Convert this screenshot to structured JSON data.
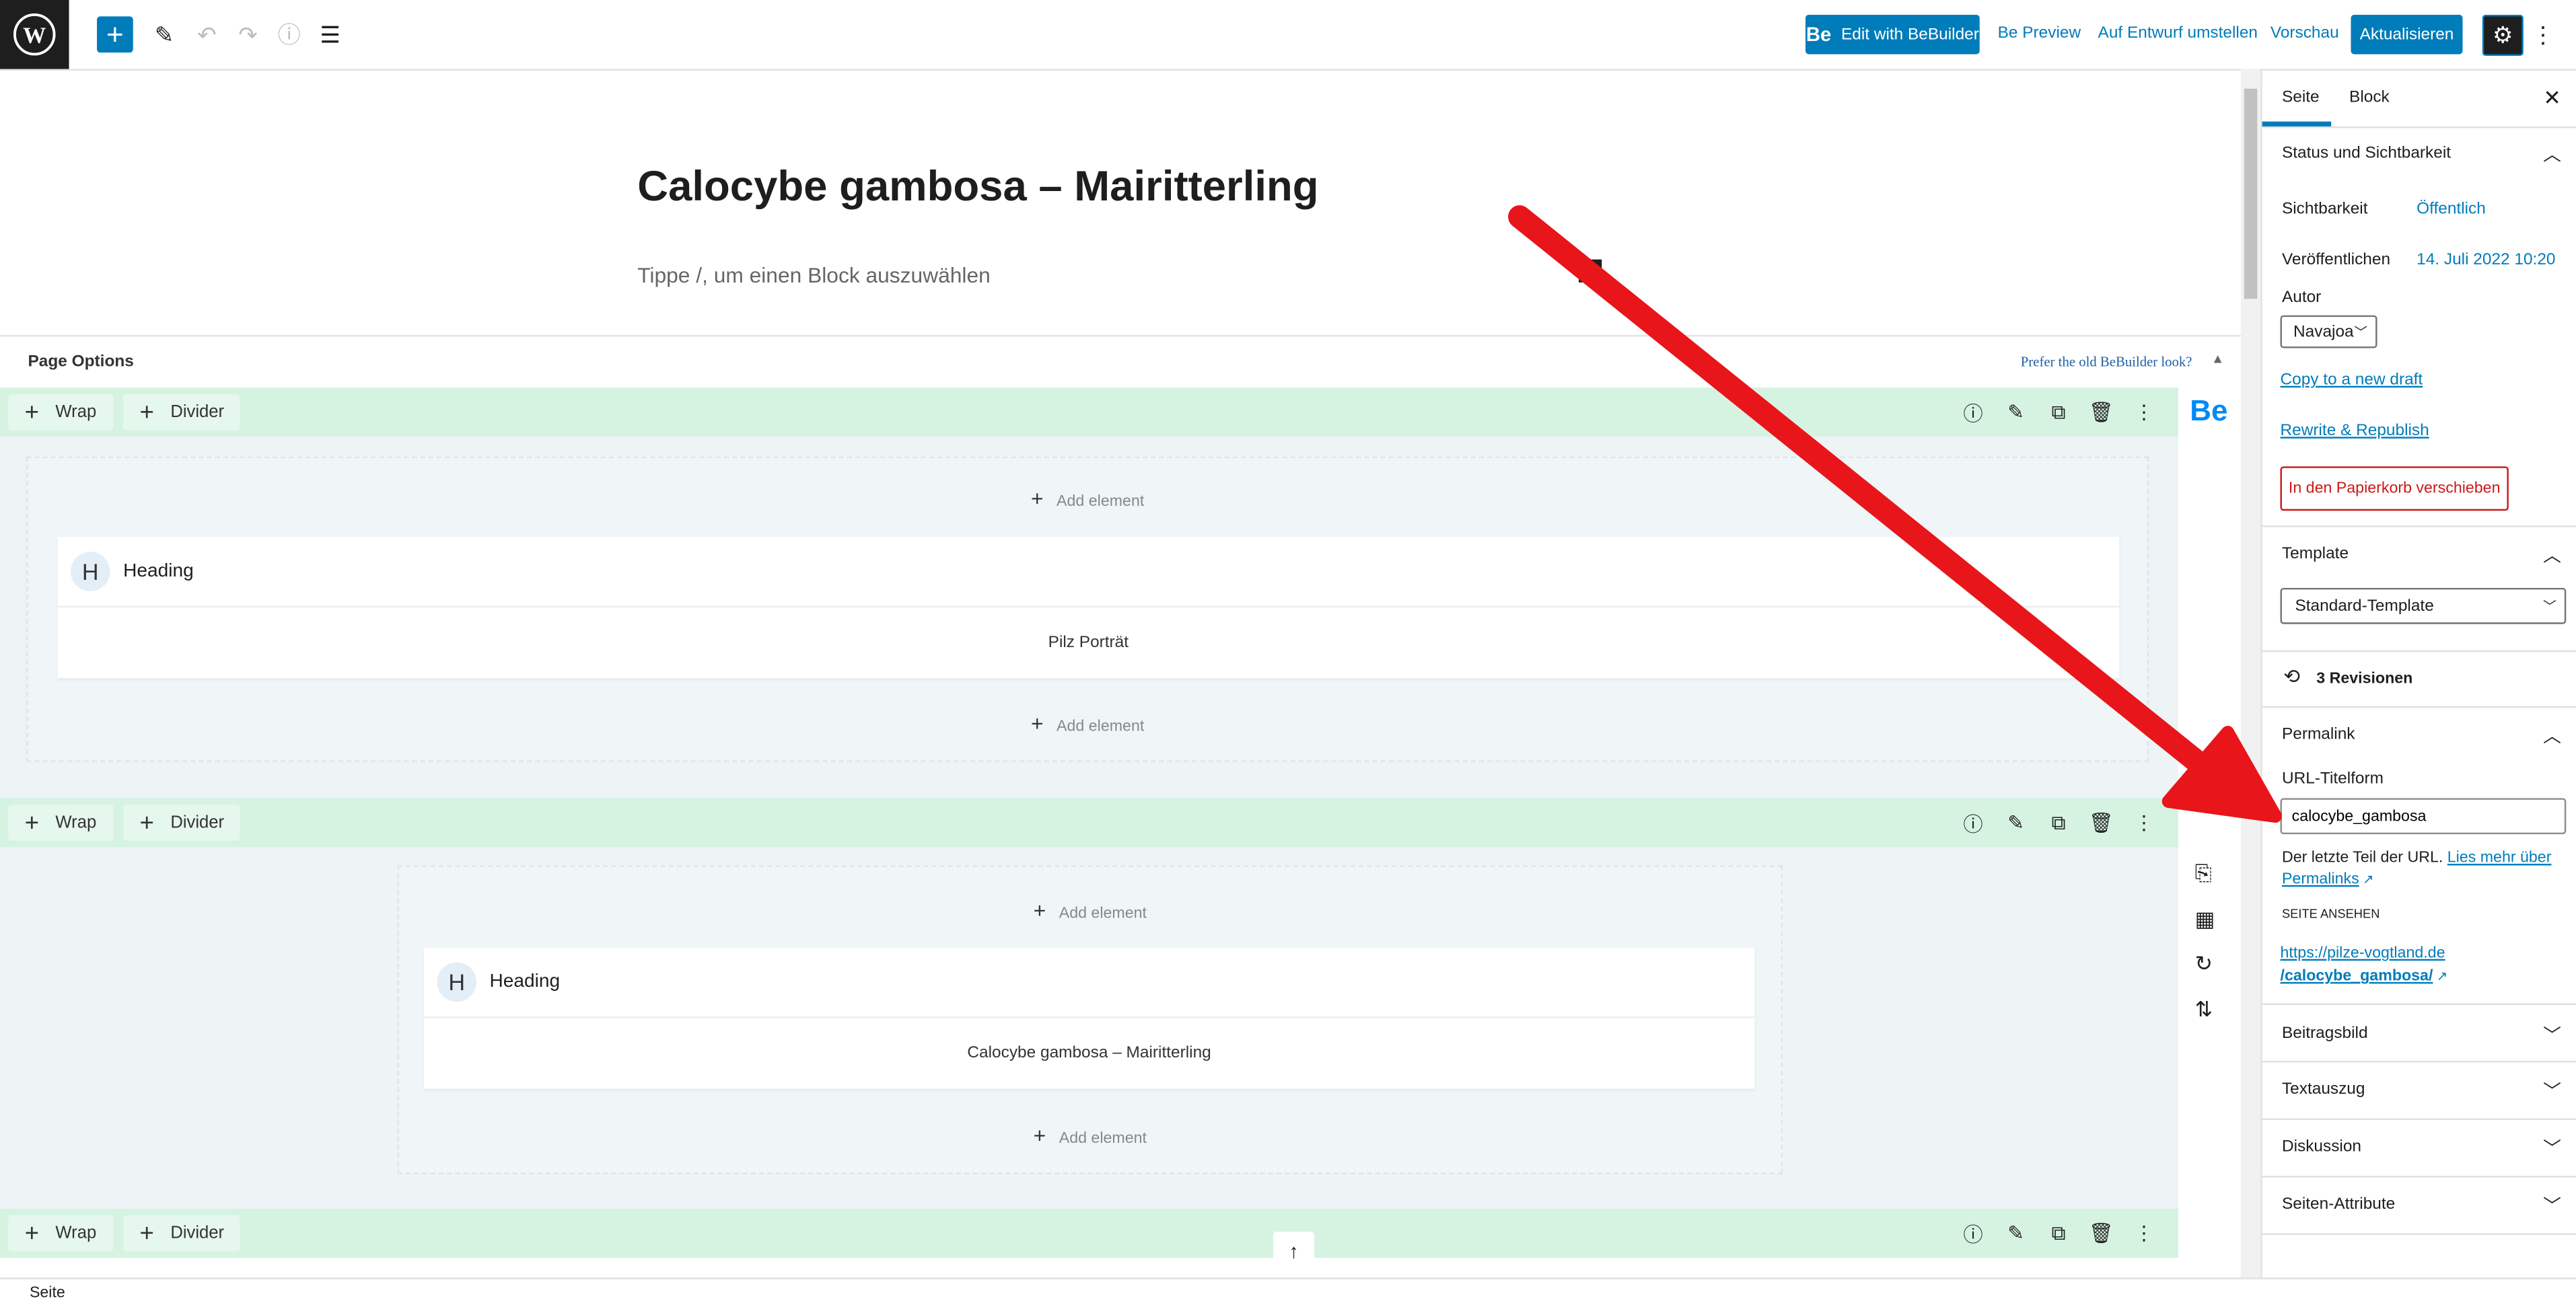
{
  "toolbar": {
    "add_label": "+",
    "edit_bebuilder": "Edit with BeBuilder",
    "be_logo": "Be",
    "be_preview": "Be Preview",
    "switch_draft": "Auf Entwurf umstellen",
    "preview": "Vorschau",
    "update": "Aktualisieren",
    "accent": "#007cba"
  },
  "editor": {
    "title": "Calocybe gambosa – Mairitterling",
    "placeholder": "Tippe /, um einen Block auszuwählen"
  },
  "page_options": {
    "label": "Page Options",
    "old_look": "Prefer the old BeBuilder look?"
  },
  "builder": {
    "wrap": "Wrap",
    "divider": "Divider",
    "add_element": "Add element",
    "be_logo": "Be",
    "sections": [
      {
        "heading_label": "Heading",
        "heading_text": "Pilz Porträt"
      },
      {
        "heading_label": "Heading",
        "heading_text": "Calocybe gambosa – Mairitterling"
      }
    ]
  },
  "status": {
    "label": "Seite"
  },
  "sidebar": {
    "tabs": [
      {
        "label": "Seite",
        "active": true
      },
      {
        "label": "Block",
        "active": false
      }
    ],
    "status_section": "Status und Sichtbarkeit",
    "visibility_label": "Sichtbarkeit",
    "visibility_value": "Öffentlich",
    "published_label": "Veröffentlichen",
    "published_value": "14. Juli 2022 10:20",
    "author_label": "Autor",
    "author_value": "Navajoa",
    "copy_draft": "Copy to a new draft",
    "rewrite": "Rewrite & Republish",
    "trash": "In den Papierkorb verschieben",
    "template_section": "Template",
    "template_value": "Standard-Template",
    "revisions": "3 Revisionen",
    "permalink_section": "Permalink",
    "slug_label": "URL-Titelform",
    "slug_value": "calocybe_gambosa",
    "help_text": "Der letzte Teil der URL.",
    "help_link": "Lies mehr über Permalinks",
    "view_label": "SEITE ANSEHEN",
    "url_line1": "https://pilze-vogtland.de",
    "url_line2": "/calocybe_gambosa/",
    "panels": [
      "Beitragsbild",
      "Textauszug",
      "Diskussion",
      "Seiten-Attribute"
    ]
  }
}
